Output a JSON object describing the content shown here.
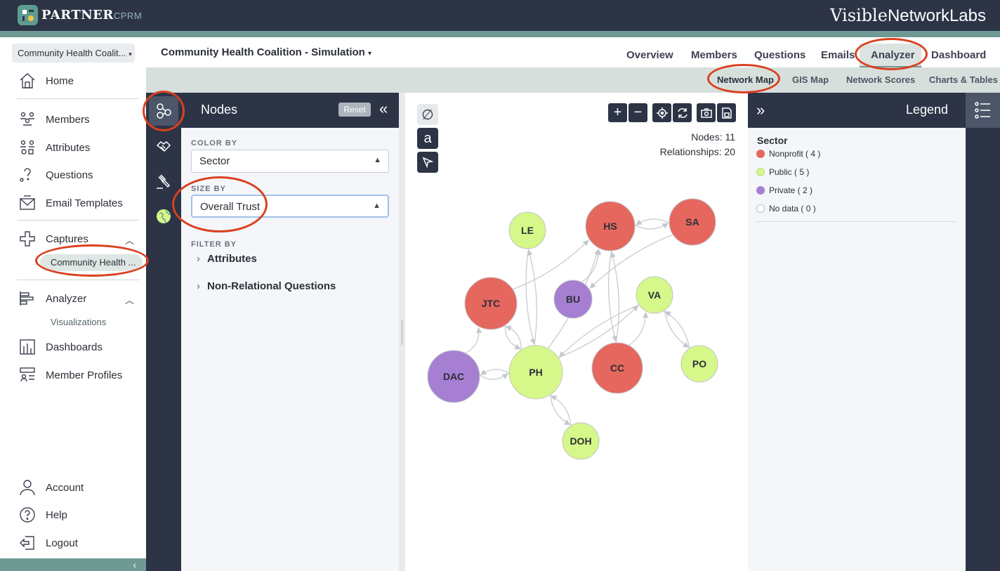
{
  "header": {
    "logo_main": "PARTNER",
    "logo_sub": "CPRM",
    "brand_bold": "Visible",
    "brand_rest": "NetworkLabs"
  },
  "sidebar": {
    "org_select": "Community Health Coalit...",
    "items": {
      "home": "Home",
      "members": "Members",
      "attributes": "Attributes",
      "questions": "Questions",
      "email_templates": "Email Templates",
      "captures": "Captures",
      "capture_item": "Community Health ...",
      "analyzer": "Analyzer",
      "visualizations": "Visualizations",
      "dashboards": "Dashboards",
      "member_profiles": "Member Profiles",
      "account": "Account",
      "help": "Help",
      "logout": "Logout"
    }
  },
  "project": {
    "title": "Community Health Coalition - Simulation"
  },
  "top_tabs": {
    "overview": "Overview",
    "members": "Members",
    "questions": "Questions",
    "emails": "Emails",
    "analyzer": "Analyzer",
    "dashboard": "Dashboard"
  },
  "sub_tabs": {
    "network_map": "Network Map",
    "gis_map": "GIS Map",
    "network_scores": "Network Scores",
    "charts_tables": "Charts & Tables"
  },
  "nodes_panel": {
    "title": "Nodes",
    "reset": "Reset",
    "color_by_label": "COLOR BY",
    "color_by_value": "Sector",
    "size_by_label": "SIZE BY",
    "size_by_value": "Overall Trust",
    "filter_by_label": "FILTER BY",
    "filter_attributes": "Attributes",
    "filter_non_relational": "Non-Relational Questions"
  },
  "canvas": {
    "nodes_stat": "Nodes: 11",
    "relationships_stat": "Relationships: 20"
  },
  "legend": {
    "title": "Legend",
    "group": "Sector",
    "items": [
      {
        "label": "Nonprofit ( 4 )",
        "color": "#e5675e"
      },
      {
        "label": "Public ( 5 )",
        "color": "#d6f78a"
      },
      {
        "label": "Private ( 2 )",
        "color": "#a67fd3"
      },
      {
        "label": "No data ( 0 )",
        "color": "#ffffff"
      }
    ]
  },
  "network": {
    "nodes": [
      {
        "id": "LE",
        "sector": "public"
      },
      {
        "id": "HS",
        "sector": "nonprofit"
      },
      {
        "id": "SA",
        "sector": "nonprofit"
      },
      {
        "id": "JTC",
        "sector": "nonprofit"
      },
      {
        "id": "BU",
        "sector": "private"
      },
      {
        "id": "VA",
        "sector": "public"
      },
      {
        "id": "DAC",
        "sector": "private"
      },
      {
        "id": "PH",
        "sector": "public"
      },
      {
        "id": "CC",
        "sector": "nonprofit"
      },
      {
        "id": "PO",
        "sector": "public"
      },
      {
        "id": "DOH",
        "sector": "public"
      }
    ],
    "edges": [
      [
        "HS",
        "SA"
      ],
      [
        "SA",
        "HS"
      ],
      [
        "SA",
        "BU"
      ],
      [
        "JTC",
        "HS"
      ],
      [
        "LE",
        "PH"
      ],
      [
        "PH",
        "LE"
      ],
      [
        "PH",
        "HS"
      ],
      [
        "BU",
        "HS"
      ],
      [
        "JTC",
        "PH"
      ],
      [
        "PH",
        "JTC"
      ],
      [
        "DAC",
        "JTC"
      ],
      [
        "DAC",
        "PH"
      ],
      [
        "PH",
        "DAC"
      ],
      [
        "PH",
        "VA"
      ],
      [
        "VA",
        "PH"
      ],
      [
        "CC",
        "HS"
      ],
      [
        "HS",
        "CC"
      ],
      [
        "VA",
        "PO"
      ],
      [
        "PO",
        "VA"
      ],
      [
        "PH",
        "DOH"
      ],
      [
        "DOH",
        "PH"
      ],
      [
        "CC",
        "VA"
      ]
    ],
    "sector_colors": {
      "nonprofit": "#e5675e",
      "public": "#d6f78a",
      "private": "#a67fd3"
    }
  }
}
